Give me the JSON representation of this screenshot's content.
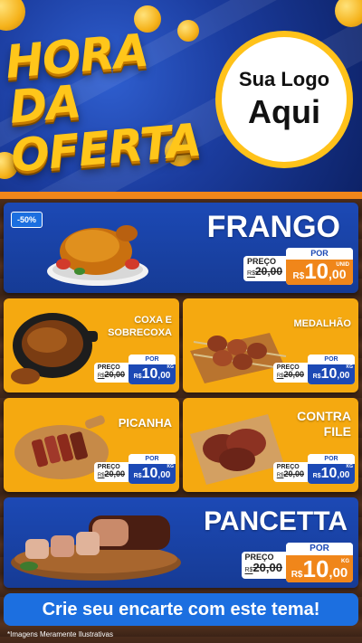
{
  "header": {
    "headline_line1": "HORA DA",
    "headline_line2": "OFERTA",
    "logo_line1": "Sua Logo",
    "logo_line2": "Aqui"
  },
  "colors": {
    "header_blue": "#1b3c9e",
    "card_blue": "#1c49b5",
    "card_orange": "#f5a910",
    "accent_orange": "#f0861a",
    "cta_blue": "#1c6fe0"
  },
  "products": {
    "frango": {
      "badge": "-50%",
      "name": "FRANGO",
      "old_label": "PREÇO",
      "old_prefix": "R$",
      "old_price": "20,00",
      "per_label": "POR",
      "currency": "R$",
      "price_int": "10",
      "price_dec": ",00",
      "unit": "UNID"
    },
    "coxa": {
      "name_line1": "COXA E",
      "name_line2": "SOBRECOXA",
      "old_label": "PREÇO",
      "old_prefix": "R$",
      "old_price": "20,00",
      "per_label": "POR",
      "currency": "R$",
      "price_int": "10",
      "price_dec": ",00",
      "unit": "KG"
    },
    "medalhao": {
      "name": "MEDALHÃO",
      "old_label": "PREÇO",
      "old_prefix": "R$",
      "old_price": "20,00",
      "per_label": "POR",
      "currency": "R$",
      "price_int": "10",
      "price_dec": ",00",
      "unit": "KG"
    },
    "picanha": {
      "name": "PICANHA",
      "old_label": "PREÇO",
      "old_prefix": "R$",
      "old_price": "20,00",
      "per_label": "POR",
      "currency": "R$",
      "price_int": "10",
      "price_dec": ",00",
      "unit": "KG"
    },
    "contrafile": {
      "name_line1": "CONTRA",
      "name_line2": "FILE",
      "old_label": "PREÇO",
      "old_prefix": "R$",
      "old_price": "20,00",
      "per_label": "POR",
      "currency": "R$",
      "price_int": "10",
      "price_dec": ",00",
      "unit": "KG"
    },
    "pancetta": {
      "name": "PANCETTA",
      "old_label": "PREÇO",
      "old_prefix": "R$",
      "old_price": "20,00",
      "per_label": "POR",
      "currency": "R$",
      "price_int": "10",
      "price_dec": ",00",
      "unit": "KG"
    }
  },
  "footer": {
    "cta": "Crie seu encarte com este tema!",
    "disclaimer": "*Imagens Meramente Ilustrativas"
  }
}
